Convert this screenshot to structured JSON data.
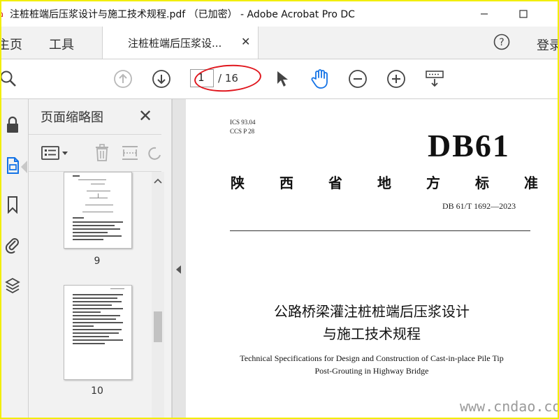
{
  "window": {
    "title": "注桩桩端后压浆设计与施工技术规程.pdf （已加密） - Adobe Acrobat Pro DC",
    "app_icon": "acrobat-icon",
    "controls": [
      "minimize-icon",
      "maximize-icon"
    ]
  },
  "tabs": {
    "home": "主页",
    "tools": "工具",
    "document": "注桩桩端后压浆设...",
    "login": "登录"
  },
  "toolbar": {
    "current_page": "1",
    "page_total": "/ 16",
    "highlight_color": "#e0161d"
  },
  "thumbnails_panel": {
    "title": "页面缩略图",
    "pages": [
      {
        "label": "9"
      },
      {
        "label": "10"
      }
    ]
  },
  "document": {
    "ics": "ICS  93.04",
    "ccs": "CCS  P  28",
    "db_label": "DB61",
    "standard_chars": [
      "陕",
      "西",
      "省",
      "地",
      "方",
      "标",
      "准"
    ],
    "code": "DB 61/T  1692—2023",
    "title_line1": "公路桥梁灌注桩桩端后压浆设计",
    "title_line2": "与施工技术规程",
    "english_line1": "Technical Specifications for Design and Construction of Cast-in-place Pile Tip",
    "english_line2": "Post-Grouting in Highway Bridge"
  },
  "watermark": "www.cndao.com",
  "colors": {
    "accent_blue": "#1473e6",
    "frame_border": "#f2ee00"
  }
}
